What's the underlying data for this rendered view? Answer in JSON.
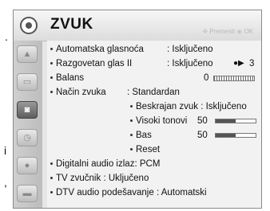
{
  "header": {
    "title": "ZVUK",
    "hint": "Premesti",
    "hint_ok": "OK"
  },
  "background": {
    "char_top": ".",
    "char_mid": "i",
    "char_bottom": ","
  },
  "sidebar": {
    "icons": [
      "photo-icon",
      "monitor-icon",
      "speaker-icon",
      "clock-icon",
      "lock-icon",
      "keyboard-icon"
    ],
    "active_index": 2
  },
  "menu": {
    "items": [
      {
        "label": "Automatska glasnoća",
        "value": ": Isključeno"
      },
      {
        "label": "Razgovetan glas II",
        "value": ": Isključeno",
        "extra": "3"
      },
      {
        "label": "Balans",
        "value": "0"
      },
      {
        "label": "Način zvuka",
        "value": ": Standardan"
      },
      {
        "label": "Beskrajan zvuk",
        "value": ": Isključeno"
      },
      {
        "label": "Visoki tonovi",
        "value": "50",
        "level": 0.5
      },
      {
        "label": "Bas",
        "value": "50",
        "level": 0.5
      },
      {
        "label": "Reset"
      },
      {
        "label": "Digitalni audio izlaz",
        "value": ": PCM"
      },
      {
        "label": "TV zvučnik",
        "value": ": Uključeno"
      },
      {
        "label": "DTV audio podešavanje",
        "value": ": Automatski"
      }
    ]
  }
}
